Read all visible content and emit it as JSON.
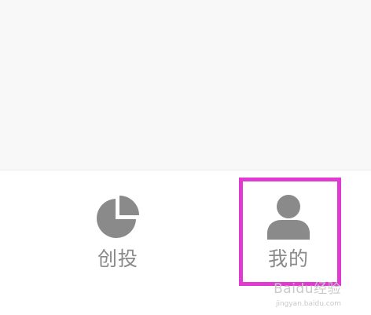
{
  "tabbar": {
    "tabs": [
      {
        "label": "创投",
        "icon": "pie-chart-icon"
      },
      {
        "label": "我的",
        "icon": "person-icon"
      }
    ]
  },
  "highlight_color": "#e03ad0",
  "watermark": {
    "brand": "Baidu经验",
    "url": "jingyan.baidu.com"
  }
}
